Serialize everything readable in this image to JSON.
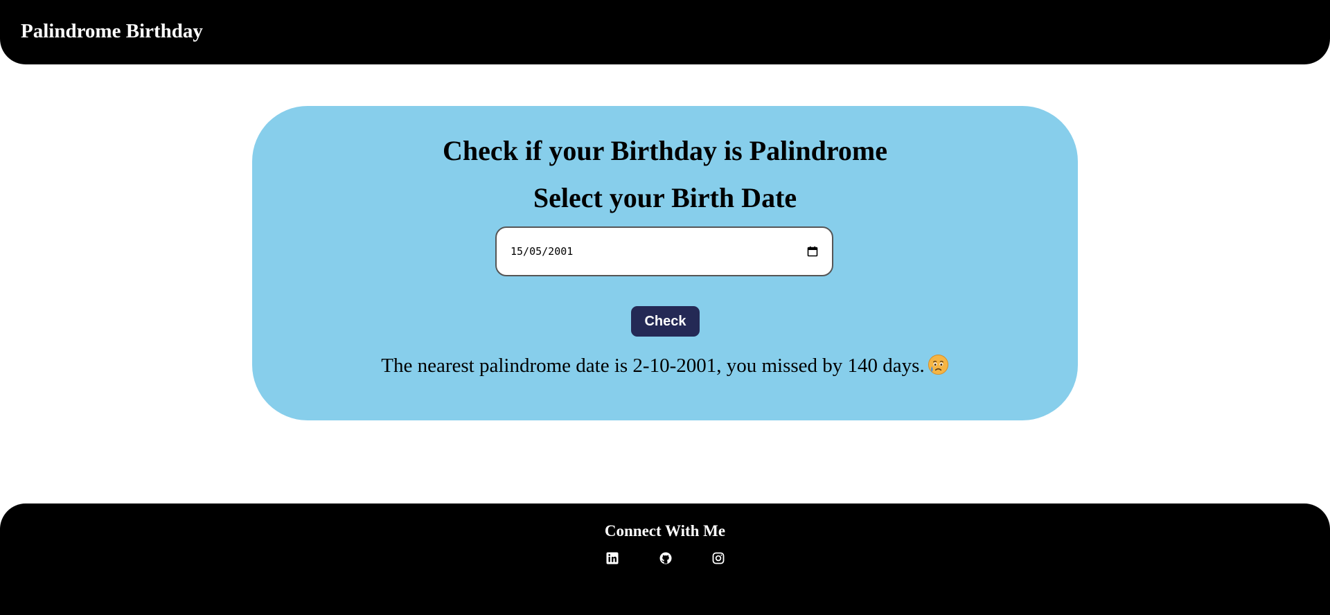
{
  "header": {
    "brand": "Palindrome Birthday"
  },
  "main": {
    "title": "Check if your Birthday is Palindrome",
    "subtitle": "Select your Birth Date",
    "date_input": {
      "value": "15/05/2001",
      "icon": "calendar-icon"
    },
    "check_label": "Check",
    "result_text": "The nearest palindrome date is 2-10-2001, you missed by 140 days.",
    "result_emoji": "sad-face-with-tear-icon"
  },
  "footer": {
    "title": "Connect With Me",
    "social_icons": [
      "linkedin-icon",
      "github-icon",
      "instagram-icon"
    ]
  },
  "colors": {
    "header_bg": "#000000",
    "card_bg": "#87ceeb",
    "button_bg": "#242955",
    "footer_bg": "#000000"
  }
}
